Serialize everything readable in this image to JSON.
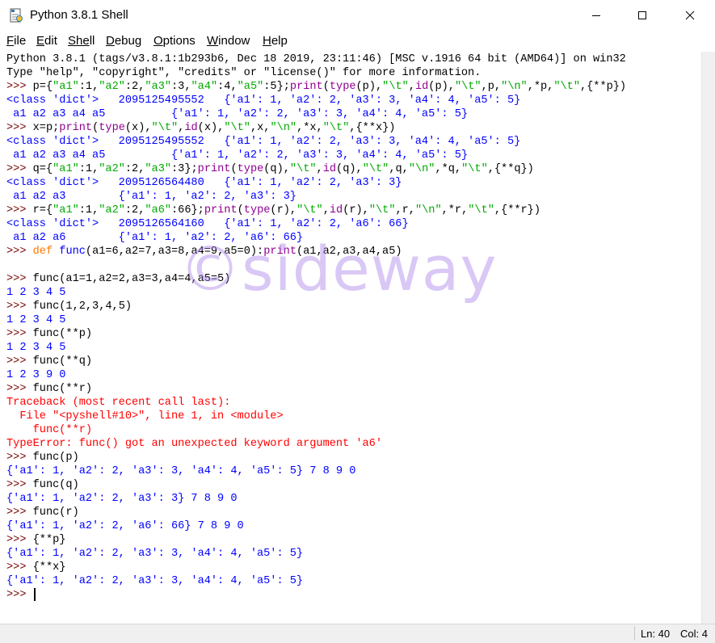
{
  "window": {
    "title": "Python 3.8.1 Shell",
    "icon": "python-shell-icon",
    "controls": [
      "minimize-icon",
      "maximize-icon",
      "close-icon"
    ]
  },
  "menu": [
    {
      "first": "F",
      "rest": "ile"
    },
    {
      "first": "E",
      "rest": "dit"
    },
    {
      "first": "She",
      "rest": "ll"
    },
    {
      "first": "D",
      "rest": "ebug"
    },
    {
      "first": "O",
      "rest": "ptions"
    },
    {
      "first": "W",
      "rest": "indow"
    },
    {
      "first": "H",
      "rest": "elp"
    }
  ],
  "shell": {
    "lines": [
      [
        {
          "c": "plain",
          "t": "Python 3.8.1 (tags/v3.8.1:1b293b6, Dec 18 2019, 23:11:46) [MSC v.1916 64 bit (AMD64)] on win32"
        }
      ],
      [
        {
          "c": "plain",
          "t": "Type \"help\", \"copyright\", \"credits\" or \"license()\" for more information."
        }
      ],
      [
        {
          "c": "prompt",
          "t": ">>> "
        },
        {
          "c": "plain",
          "t": "p={"
        },
        {
          "c": "str",
          "t": "\"a1\""
        },
        {
          "c": "plain",
          "t": ":1,"
        },
        {
          "c": "str",
          "t": "\"a2\""
        },
        {
          "c": "plain",
          "t": ":2,"
        },
        {
          "c": "str",
          "t": "\"a3\""
        },
        {
          "c": "plain",
          "t": ":3,"
        },
        {
          "c": "str",
          "t": "\"a4\""
        },
        {
          "c": "plain",
          "t": ":4,"
        },
        {
          "c": "str",
          "t": "\"a5\""
        },
        {
          "c": "plain",
          "t": ":5};"
        },
        {
          "c": "builtin",
          "t": "print"
        },
        {
          "c": "plain",
          "t": "("
        },
        {
          "c": "builtin",
          "t": "type"
        },
        {
          "c": "plain",
          "t": "(p),"
        },
        {
          "c": "str",
          "t": "\"\\t\""
        },
        {
          "c": "plain",
          "t": ","
        },
        {
          "c": "builtin",
          "t": "id"
        },
        {
          "c": "plain",
          "t": "(p),"
        },
        {
          "c": "str",
          "t": "\"\\t\""
        },
        {
          "c": "plain",
          "t": ",p,"
        },
        {
          "c": "str",
          "t": "\"\\n\""
        },
        {
          "c": "plain",
          "t": ",*p,"
        },
        {
          "c": "str",
          "t": "\"\\t\""
        },
        {
          "c": "plain",
          "t": ",{**p})"
        }
      ],
      [
        {
          "c": "out",
          "t": "<class 'dict'>   2095125495552   {'a1': 1, 'a2': 2, 'a3': 3, 'a4': 4, 'a5': 5}"
        }
      ],
      [
        {
          "c": "out",
          "t": " a1 a2 a3 a4 a5          {'a1': 1, 'a2': 2, 'a3': 3, 'a4': 4, 'a5': 5}"
        }
      ],
      [
        {
          "c": "prompt",
          "t": ">>> "
        },
        {
          "c": "plain",
          "t": "x=p;"
        },
        {
          "c": "builtin",
          "t": "print"
        },
        {
          "c": "plain",
          "t": "("
        },
        {
          "c": "builtin",
          "t": "type"
        },
        {
          "c": "plain",
          "t": "(x),"
        },
        {
          "c": "str",
          "t": "\"\\t\""
        },
        {
          "c": "plain",
          "t": ","
        },
        {
          "c": "builtin",
          "t": "id"
        },
        {
          "c": "plain",
          "t": "(x),"
        },
        {
          "c": "str",
          "t": "\"\\t\""
        },
        {
          "c": "plain",
          "t": ",x,"
        },
        {
          "c": "str",
          "t": "\"\\n\""
        },
        {
          "c": "plain",
          "t": ",*x,"
        },
        {
          "c": "str",
          "t": "\"\\t\""
        },
        {
          "c": "plain",
          "t": ",{**x})"
        }
      ],
      [
        {
          "c": "out",
          "t": "<class 'dict'>   2095125495552   {'a1': 1, 'a2': 2, 'a3': 3, 'a4': 4, 'a5': 5}"
        }
      ],
      [
        {
          "c": "out",
          "t": " a1 a2 a3 a4 a5          {'a1': 1, 'a2': 2, 'a3': 3, 'a4': 4, 'a5': 5}"
        }
      ],
      [
        {
          "c": "prompt",
          "t": ">>> "
        },
        {
          "c": "plain",
          "t": "q={"
        },
        {
          "c": "str",
          "t": "\"a1\""
        },
        {
          "c": "plain",
          "t": ":1,"
        },
        {
          "c": "str",
          "t": "\"a2\""
        },
        {
          "c": "plain",
          "t": ":2,"
        },
        {
          "c": "str",
          "t": "\"a3\""
        },
        {
          "c": "plain",
          "t": ":3};"
        },
        {
          "c": "builtin",
          "t": "print"
        },
        {
          "c": "plain",
          "t": "("
        },
        {
          "c": "builtin",
          "t": "type"
        },
        {
          "c": "plain",
          "t": "(q),"
        },
        {
          "c": "str",
          "t": "\"\\t\""
        },
        {
          "c": "plain",
          "t": ","
        },
        {
          "c": "builtin",
          "t": "id"
        },
        {
          "c": "plain",
          "t": "(q),"
        },
        {
          "c": "str",
          "t": "\"\\t\""
        },
        {
          "c": "plain",
          "t": ",q,"
        },
        {
          "c": "str",
          "t": "\"\\n\""
        },
        {
          "c": "plain",
          "t": ",*q,"
        },
        {
          "c": "str",
          "t": "\"\\t\""
        },
        {
          "c": "plain",
          "t": ",{**q})"
        }
      ],
      [
        {
          "c": "out",
          "t": "<class 'dict'>   2095126564480   {'a1': 1, 'a2': 2, 'a3': 3}"
        }
      ],
      [
        {
          "c": "out",
          "t": " a1 a2 a3        {'a1': 1, 'a2': 2, 'a3': 3}"
        }
      ],
      [
        {
          "c": "prompt",
          "t": ">>> "
        },
        {
          "c": "plain",
          "t": "r={"
        },
        {
          "c": "str",
          "t": "\"a1\""
        },
        {
          "c": "plain",
          "t": ":1,"
        },
        {
          "c": "str",
          "t": "\"a2\""
        },
        {
          "c": "plain",
          "t": ":2,"
        },
        {
          "c": "str",
          "t": "\"a6\""
        },
        {
          "c": "plain",
          "t": ":66};"
        },
        {
          "c": "builtin",
          "t": "print"
        },
        {
          "c": "plain",
          "t": "("
        },
        {
          "c": "builtin",
          "t": "type"
        },
        {
          "c": "plain",
          "t": "(r),"
        },
        {
          "c": "str",
          "t": "\"\\t\""
        },
        {
          "c": "plain",
          "t": ","
        },
        {
          "c": "builtin",
          "t": "id"
        },
        {
          "c": "plain",
          "t": "(r),"
        },
        {
          "c": "str",
          "t": "\"\\t\""
        },
        {
          "c": "plain",
          "t": ",r,"
        },
        {
          "c": "str",
          "t": "\"\\n\""
        },
        {
          "c": "plain",
          "t": ",*r,"
        },
        {
          "c": "str",
          "t": "\"\\t\""
        },
        {
          "c": "plain",
          "t": ",{**r})"
        }
      ],
      [
        {
          "c": "out",
          "t": "<class 'dict'>   2095126564160   {'a1': 1, 'a2': 2, 'a6': 66}"
        }
      ],
      [
        {
          "c": "out",
          "t": " a1 a2 a6        {'a1': 1, 'a2': 2, 'a6': 66}"
        }
      ],
      [
        {
          "c": "prompt",
          "t": ">>> "
        },
        {
          "c": "key",
          "t": "def "
        },
        {
          "c": "out",
          "t": "func"
        },
        {
          "c": "plain",
          "t": "(a1=6,a2=7,a3=8,a4=9,a5=0):"
        },
        {
          "c": "builtin",
          "t": "print"
        },
        {
          "c": "plain",
          "t": "(a1,a2,a3,a4,a5)"
        }
      ],
      [],
      [
        {
          "c": "prompt",
          "t": ">>> "
        },
        {
          "c": "plain",
          "t": "func(a1=1,a2=2,a3=3,a4=4,a5=5)"
        }
      ],
      [
        {
          "c": "out",
          "t": "1 2 3 4 5"
        }
      ],
      [
        {
          "c": "prompt",
          "t": ">>> "
        },
        {
          "c": "plain",
          "t": "func(1,2,3,4,5)"
        }
      ],
      [
        {
          "c": "out",
          "t": "1 2 3 4 5"
        }
      ],
      [
        {
          "c": "prompt",
          "t": ">>> "
        },
        {
          "c": "plain",
          "t": "func(**p)"
        }
      ],
      [
        {
          "c": "out",
          "t": "1 2 3 4 5"
        }
      ],
      [
        {
          "c": "prompt",
          "t": ">>> "
        },
        {
          "c": "plain",
          "t": "func(**q)"
        }
      ],
      [
        {
          "c": "out",
          "t": "1 2 3 9 0"
        }
      ],
      [
        {
          "c": "prompt",
          "t": ">>> "
        },
        {
          "c": "plain",
          "t": "func(**r)"
        }
      ],
      [
        {
          "c": "err",
          "t": "Traceback (most recent call last):"
        }
      ],
      [
        {
          "c": "err",
          "t": "  File \"<pyshell#10>\", line 1, in <module>"
        }
      ],
      [
        {
          "c": "err",
          "t": "    func(**r)"
        }
      ],
      [
        {
          "c": "err",
          "t": "TypeError: func() got an unexpected keyword argument 'a6'"
        }
      ],
      [
        {
          "c": "prompt",
          "t": ">>> "
        },
        {
          "c": "plain",
          "t": "func(p)"
        }
      ],
      [
        {
          "c": "out",
          "t": "{'a1': 1, 'a2': 2, 'a3': 3, 'a4': 4, 'a5': 5} 7 8 9 0"
        }
      ],
      [
        {
          "c": "prompt",
          "t": ">>> "
        },
        {
          "c": "plain",
          "t": "func(q)"
        }
      ],
      [
        {
          "c": "out",
          "t": "{'a1': 1, 'a2': 2, 'a3': 3} 7 8 9 0"
        }
      ],
      [
        {
          "c": "prompt",
          "t": ">>> "
        },
        {
          "c": "plain",
          "t": "func(r)"
        }
      ],
      [
        {
          "c": "out",
          "t": "{'a1': 1, 'a2': 2, 'a6': 66} 7 8 9 0"
        }
      ],
      [
        {
          "c": "prompt",
          "t": ">>> "
        },
        {
          "c": "plain",
          "t": "{**p}"
        }
      ],
      [
        {
          "c": "out",
          "t": "{'a1': 1, 'a2': 2, 'a3': 3, 'a4': 4, 'a5': 5}"
        }
      ],
      [
        {
          "c": "prompt",
          "t": ">>> "
        },
        {
          "c": "plain",
          "t": "{**x}"
        }
      ],
      [
        {
          "c": "out",
          "t": "{'a1': 1, 'a2': 2, 'a3': 3, 'a4': 4, 'a5': 5}"
        }
      ],
      [
        {
          "c": "prompt",
          "t": ">>> "
        }
      ]
    ]
  },
  "watermark": "©sideway",
  "status": {
    "line": "Ln: 40",
    "col": "Col: 4"
  }
}
